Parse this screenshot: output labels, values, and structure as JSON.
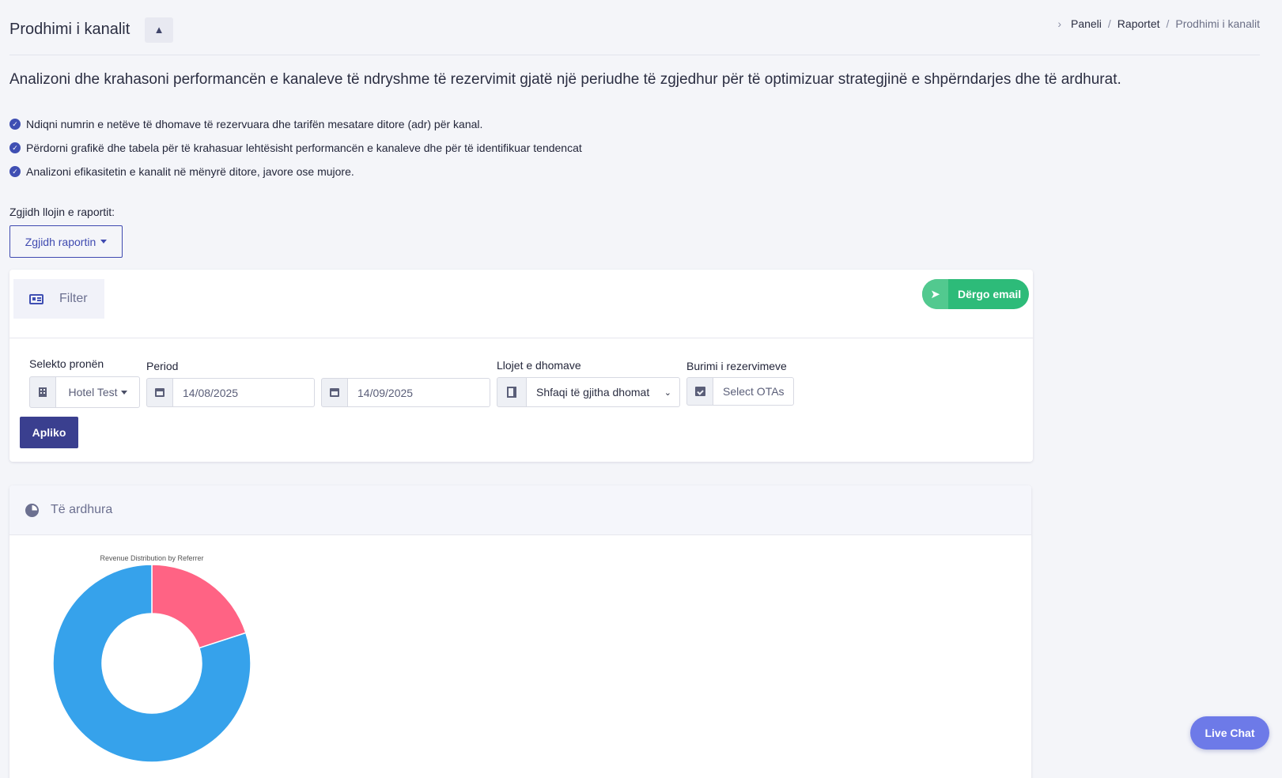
{
  "header": {
    "title": "Prodhimi i kanalit",
    "collapse_glyph": "▲",
    "breadcrumb": [
      "Paneli",
      "Raportet",
      "Prodhimi i kanalit"
    ]
  },
  "intro": "Analizoni dhe krahasoni performancën e kanaleve të ndryshme të rezervimit gjatë një periudhe të zgjedhur për të optimizuar strategjinë e shpërndarjes dhe të ardhurat.",
  "bullets": [
    "Ndiqni numrin e netëve të dhomave të rezervuara dhe tarifën mesatare ditore (adr) për kanal.",
    "Përdorni grafikë dhe tabela për të krahasuar lehtësisht performancën e kanaleve dhe për të identifikuar tendencat",
    "Analizoni efikasitetin e kanalit në mënyrë ditore, javore ose mujore."
  ],
  "report": {
    "label": "Zgjidh llojin e raportit:",
    "button": "Zgjidh raportin"
  },
  "filter": {
    "tab_label": "Filter",
    "email_button": "Dërgo email",
    "property_label": "Selekto pronën",
    "property_value": "Hotel Test",
    "period_label": "Period",
    "date_from": "14/08/2025",
    "date_to": "14/09/2025",
    "room_types_label": "Llojet e dhomave",
    "room_types_value": "Shfaqi të gjitha dhomat",
    "source_label": "Burimi i rezervimeve",
    "source_placeholder": "Select OTAs",
    "apply_button": "Apliko"
  },
  "revenue": {
    "title": "Të ardhura"
  },
  "chart_data": {
    "type": "pie",
    "title": "Revenue Distribution by Referrer",
    "donut": true,
    "slices": [
      {
        "value": 20,
        "color": "#ff6384"
      },
      {
        "value": 80,
        "color": "#36a2eb"
      }
    ]
  },
  "live_chat": "Live Chat",
  "colors": {
    "accent": "#3f4ab0",
    "email_green": "#2dbb79",
    "apply_button": "#3a3f8f",
    "live_chat": "#6d7ae8"
  }
}
